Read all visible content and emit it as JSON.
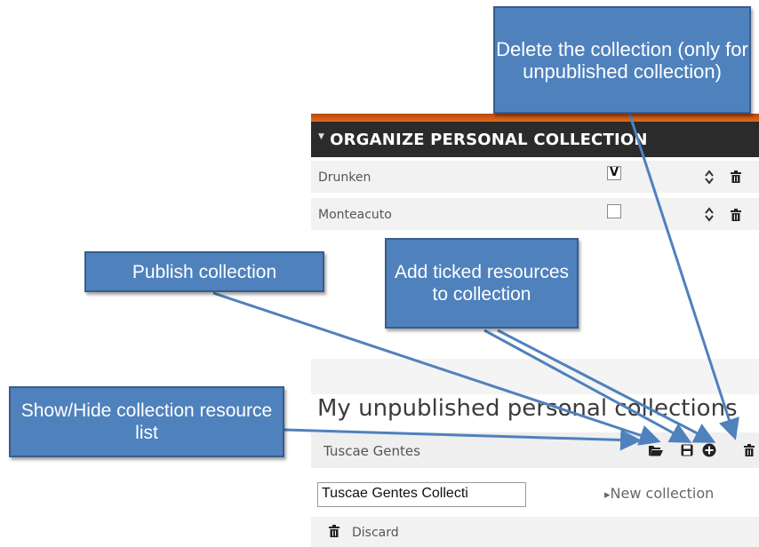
{
  "panel": {
    "title": "ORGANIZE PERSONAL COLLECTION",
    "rows": [
      {
        "name": "Drunken",
        "checked": true,
        "check_glyph": "V"
      },
      {
        "name": "Monteacuto",
        "checked": false,
        "check_glyph": ""
      }
    ]
  },
  "unpublished": {
    "title": "My unpublished personal collections",
    "collection_name": "Tuscae Gentes",
    "input_value": "Tuscae Gentes Collecti",
    "new_collection_label": "New collection",
    "new_collection_arrow": "▸",
    "discard_label": "Discard"
  },
  "callouts": {
    "delete": "Delete the collection (only for unpublished collection)",
    "publish": "Publish collection",
    "add": "Add ticked resources to collection",
    "showhide": "Show/Hide collection resource list"
  },
  "icons": {
    "folder": "folder-icon",
    "save": "save-icon",
    "add": "plus-circle-icon",
    "trash": "trash-icon",
    "sort": "sort-icon"
  },
  "colors": {
    "callout_fill": "#4f81bd",
    "callout_border": "#385d8a",
    "header_bg": "#2b2b2b",
    "header_accent": "#e46a1c"
  }
}
